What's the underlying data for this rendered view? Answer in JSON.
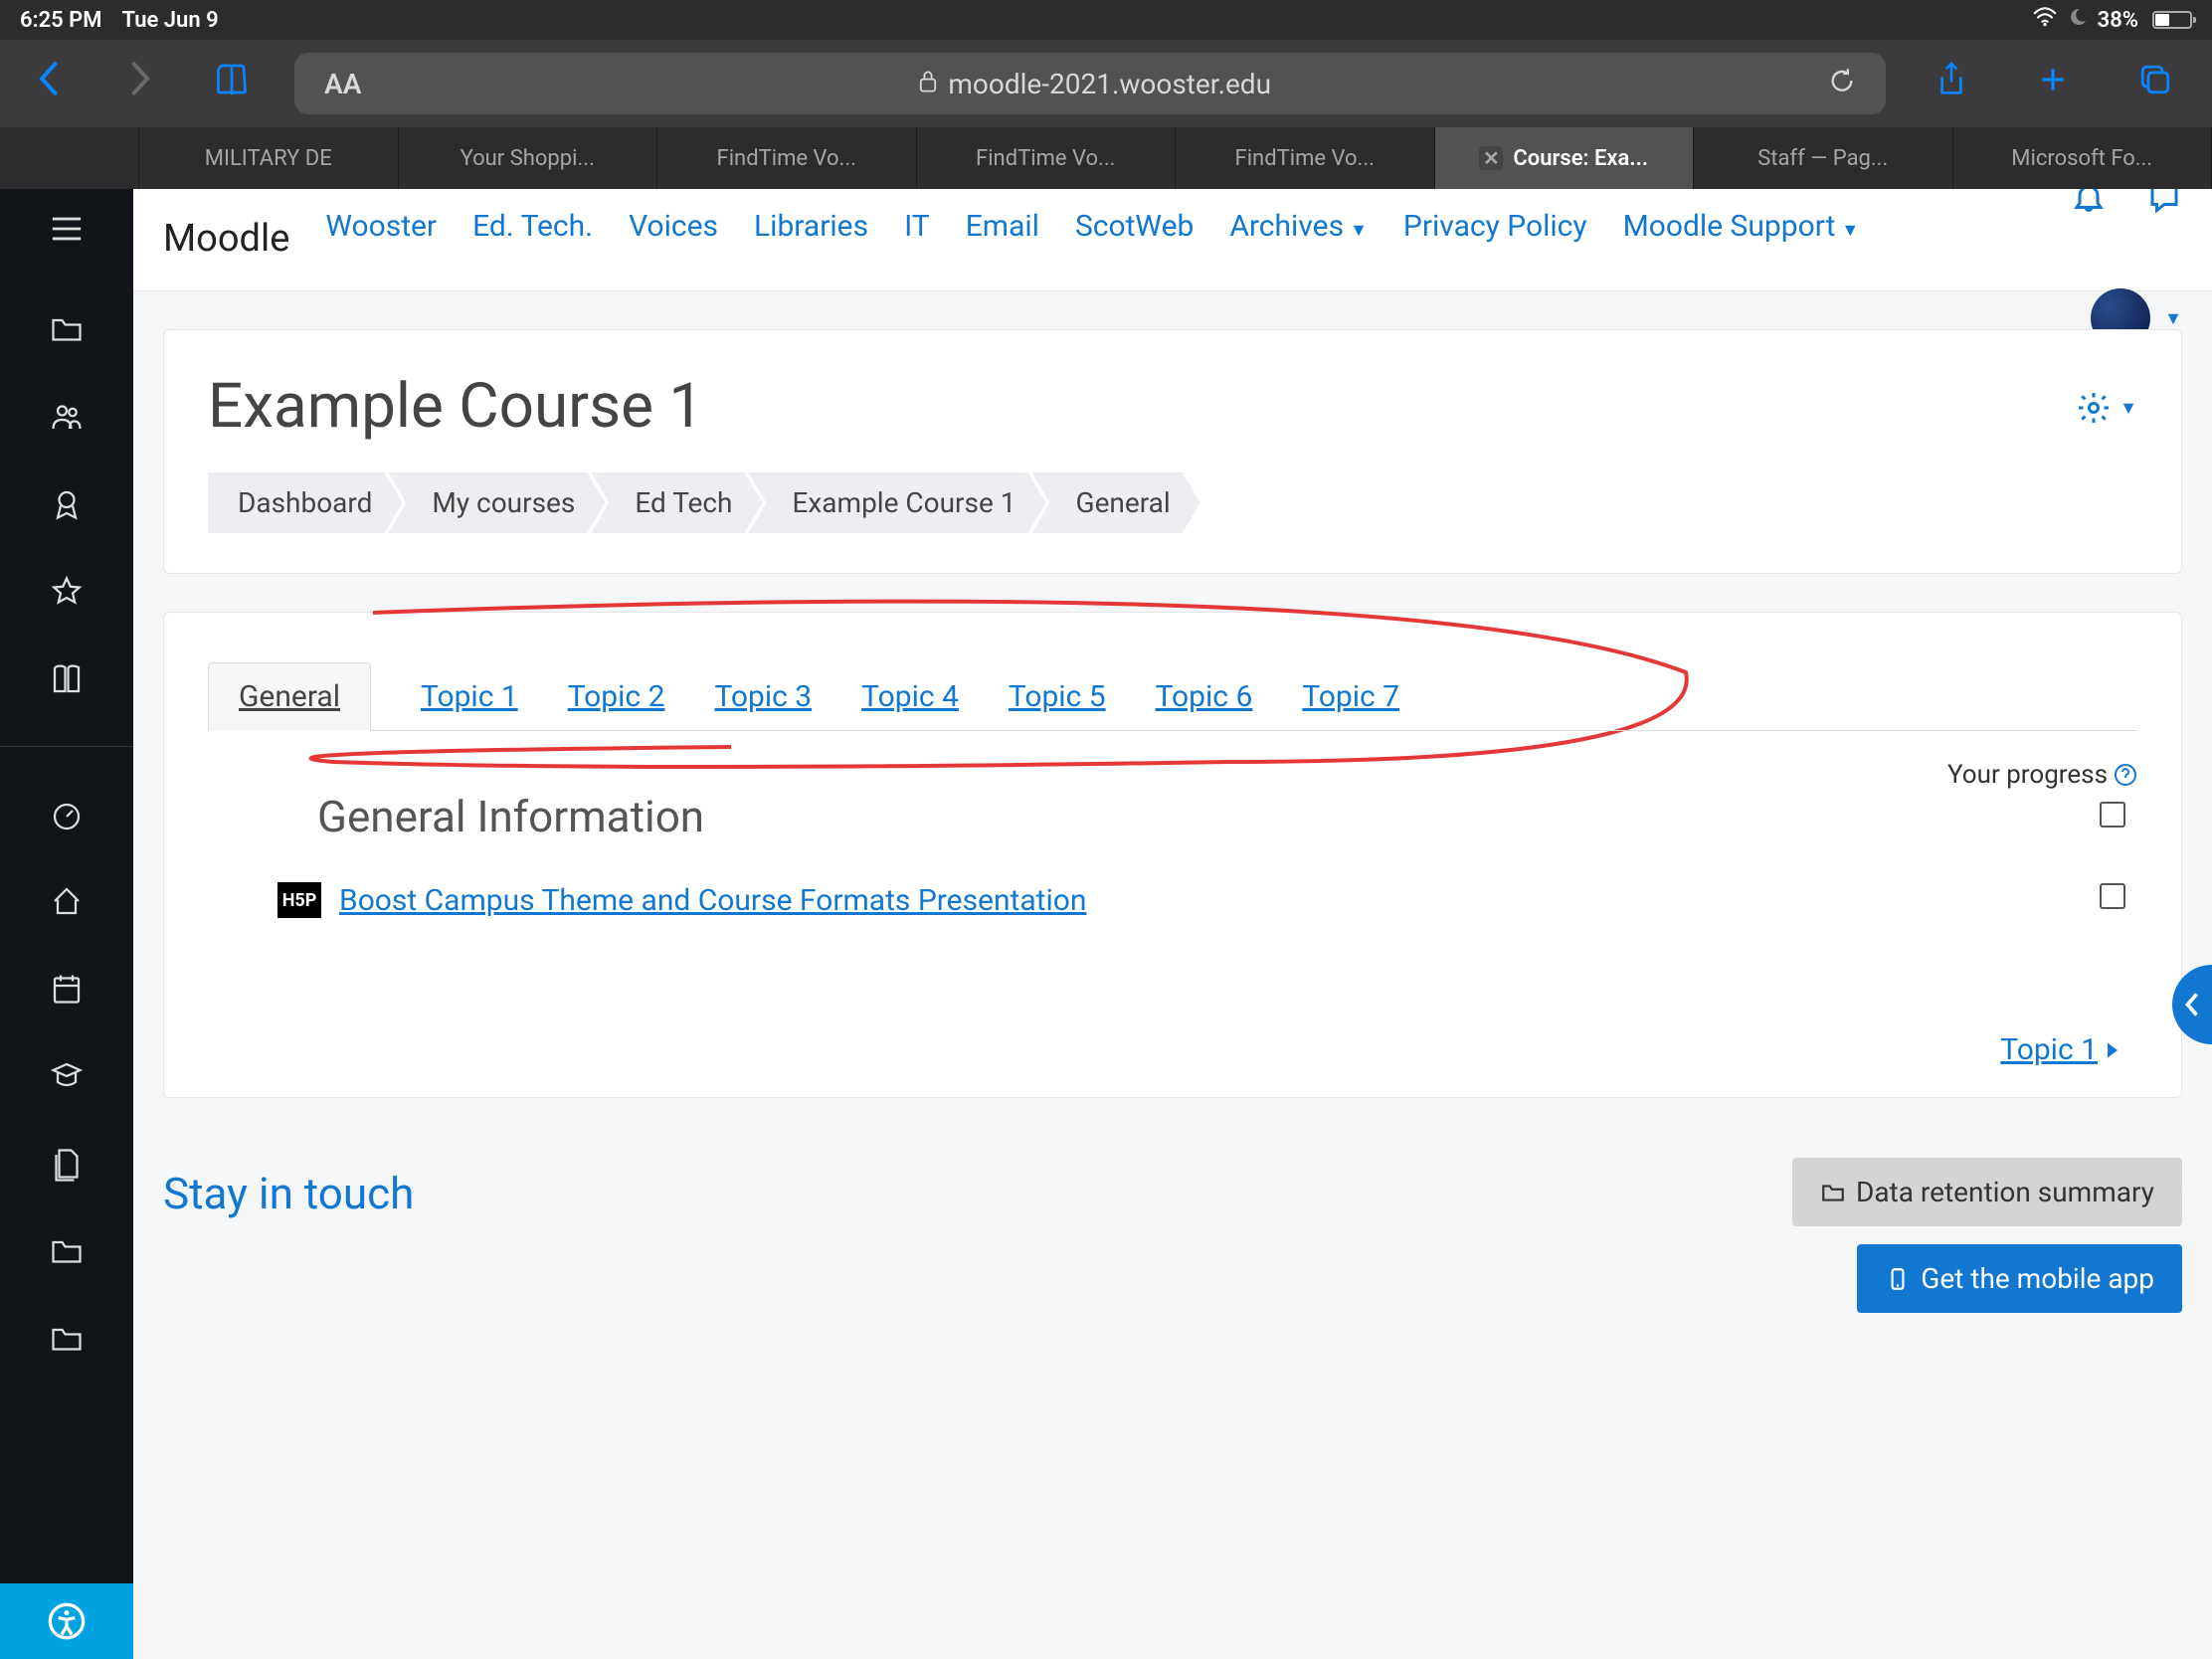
{
  "status": {
    "time": "6:25 PM",
    "date": "Tue Jun 9",
    "battery": "38%"
  },
  "browser": {
    "url": "moodle-2021.wooster.edu",
    "text_size": "AA",
    "tabs": [
      "MILITARY DE",
      "Your Shoppi...",
      "FindTime Vo...",
      "FindTime Vo...",
      "FindTime Vo...",
      "Course: Exa...",
      "Staff — Pag...",
      "Microsoft Fo..."
    ]
  },
  "moodle_nav": {
    "brand": "Moodle",
    "items": [
      "Wooster",
      "Ed. Tech.",
      "Voices",
      "Libraries",
      "IT",
      "Email",
      "ScotWeb",
      "Archives",
      "Privacy Policy",
      "Moodle Support"
    ]
  },
  "course": {
    "title": "Example Course 1",
    "breadcrumbs": [
      "Dashboard",
      "My courses",
      "Ed Tech",
      "Example Course 1",
      "General"
    ],
    "tabs": [
      "General",
      "Topic 1",
      "Topic 2",
      "Topic 3",
      "Topic 4",
      "Topic 5",
      "Topic 6",
      "Topic 7"
    ],
    "section_heading": "General Information",
    "progress_label": "Your progress",
    "activity": "Boost Campus Theme and Course Formats Presentation",
    "next_link": "Topic 1"
  },
  "footer": {
    "heading": "Stay in touch",
    "data_retention": "Data retention summary",
    "mobile_app": "Get the mobile app"
  }
}
